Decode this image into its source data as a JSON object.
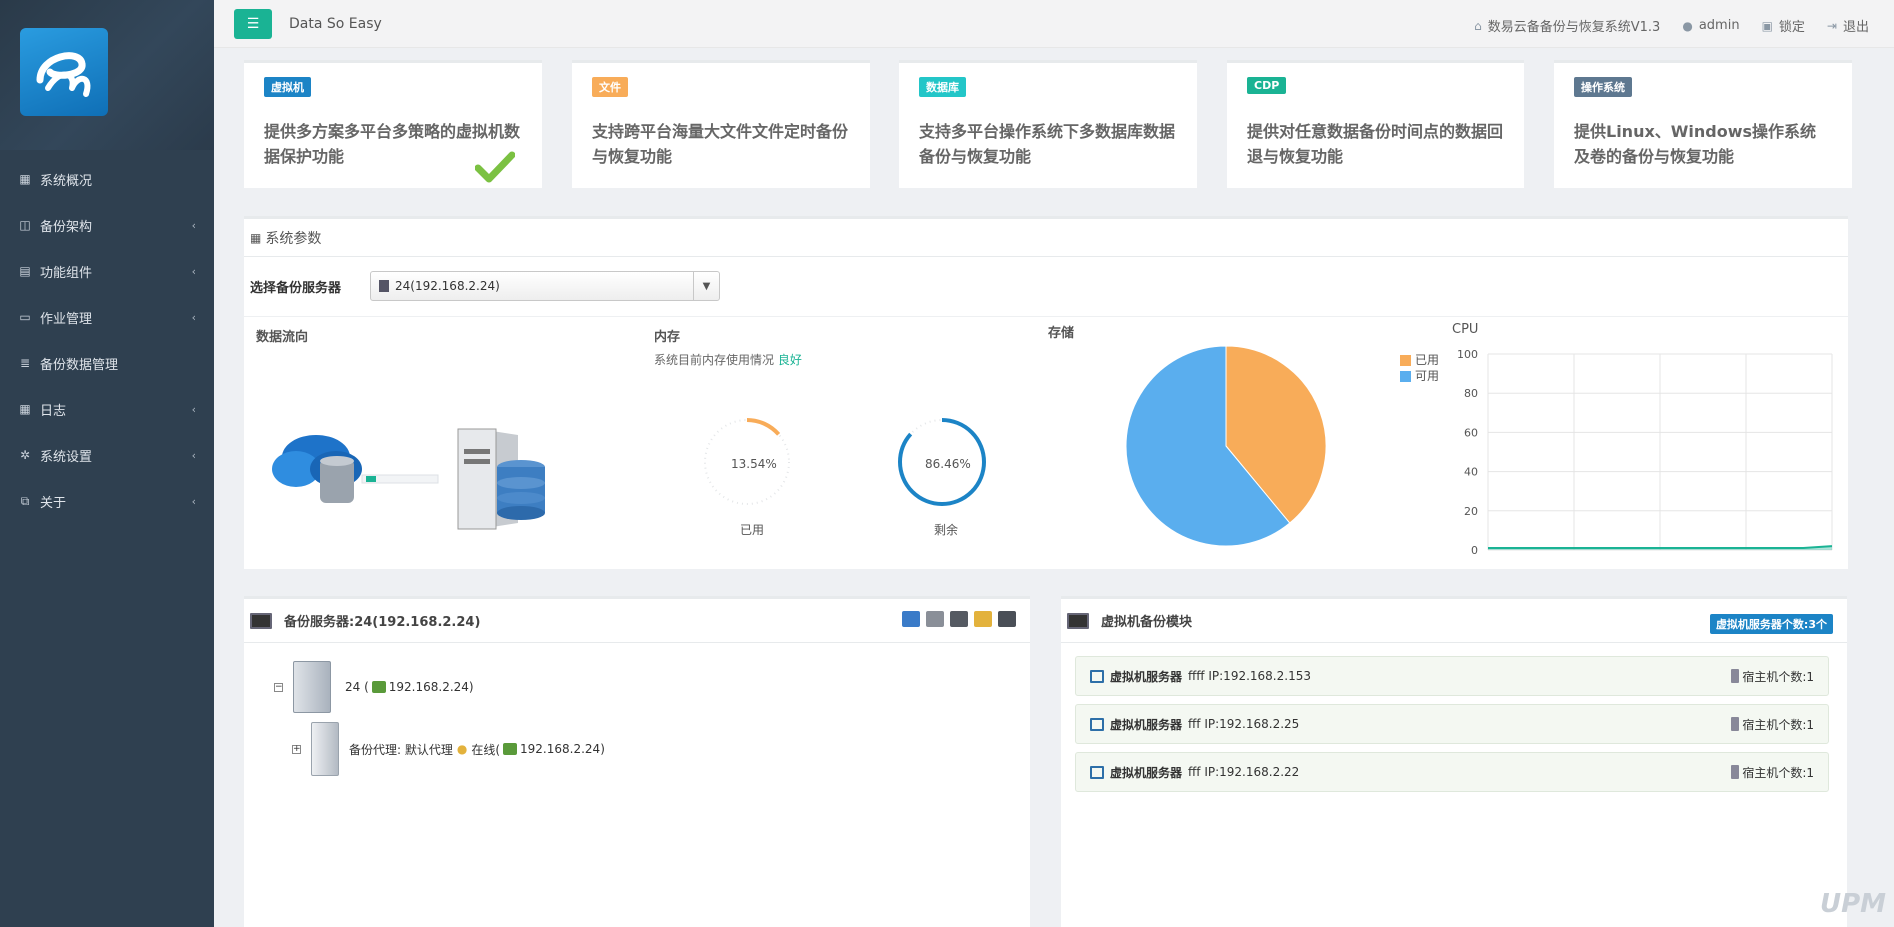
{
  "app": {
    "brand": "Data So Easy",
    "system_title": "数易云备备份与恢复系统V1.3",
    "user": "admin",
    "lock_label": "锁定",
    "logout_label": "退出"
  },
  "sidebar": {
    "items": [
      {
        "label": "系统概况",
        "icon": "dashboard-icon",
        "has_submenu": false
      },
      {
        "label": "备份架构",
        "icon": "columns-icon",
        "has_submenu": true
      },
      {
        "label": "功能组件",
        "icon": "chart-icon",
        "has_submenu": true
      },
      {
        "label": "作业管理",
        "icon": "monitor-icon",
        "has_submenu": true
      },
      {
        "label": "备份数据管理",
        "icon": "database-icon",
        "has_submenu": false
      },
      {
        "label": "日志",
        "icon": "table-icon",
        "has_submenu": true
      },
      {
        "label": "系统设置",
        "icon": "gear-icon",
        "has_submenu": true
      },
      {
        "label": "关于",
        "icon": "copy-icon",
        "has_submenu": true
      }
    ]
  },
  "features": [
    {
      "badge": "虚拟机",
      "badge_color": "#1c84c6",
      "desc": "提供多方案多平台多策略的虚拟机数据保护功能"
    },
    {
      "badge": "文件",
      "badge_color": "#f8ac59",
      "desc": "支持跨平台海量大文件文件定时备份与恢复功能"
    },
    {
      "badge": "数据库",
      "badge_color": "#23c6c8",
      "desc": "支持多平台操作系统下多数据库数据备份与恢复功能"
    },
    {
      "badge": "CDP",
      "badge_color": "#1ab394",
      "desc": "提供对任意数据备份时间点的数据回退与恢复功能"
    },
    {
      "badge": "操作系统",
      "badge_color": "#5e7890",
      "desc": "提供Linux、Windows操作系统及卷的备份与恢复功能"
    }
  ],
  "params": {
    "title": "系统参数",
    "select_label": "选择备份服务器",
    "select_value": "24(192.168.2.24)",
    "dataflow_title": "数据流向",
    "memory": {
      "title": "内存",
      "note": "系统目前内存使用情况",
      "status": "良好",
      "used_pct": 13.54,
      "used_text": "13.54%",
      "used_label": "已用",
      "free_pct": 86.46,
      "free_text": "86.46%",
      "free_label": "剩余"
    },
    "storage": {
      "title": "存储",
      "legend_used": "已用",
      "legend_free": "可用",
      "used_color": "#f8ac59",
      "free_color": "#5aaeee"
    },
    "cpu": {
      "title": "CPU",
      "yticks": [
        "100",
        "80",
        "60",
        "40",
        "20",
        "0"
      ]
    }
  },
  "chart_data": [
    {
      "type": "pie",
      "title": "存储",
      "categories": [
        "已用",
        "可用"
      ],
      "values": [
        39,
        61
      ]
    },
    {
      "type": "line",
      "title": "CPU",
      "ylim": [
        0,
        100
      ],
      "series": [
        {
          "values": [
            1,
            1,
            1,
            1,
            1,
            1,
            1,
            1,
            1,
            1,
            1,
            1,
            2
          ]
        }
      ]
    }
  ],
  "backup_server": {
    "title": "备份服务器:24(192.168.2.24)",
    "node_label": "24 (",
    "node_ip": "192.168.2.24)",
    "agent_label": "备份代理: 默认代理",
    "agent_status": "在线(",
    "agent_ip": "192.168.2.24)"
  },
  "vm_module": {
    "title": "虚拟机备份模块",
    "count_badge": "虚拟机服务器个数:3个",
    "rows": [
      {
        "name": "虚拟机服务器",
        "detail": "ffff IP:192.168.2.153",
        "hosts": "宿主机个数:1"
      },
      {
        "name": "虚拟机服务器",
        "detail": "fff IP:192.168.2.25",
        "hosts": "宿主机个数:1"
      },
      {
        "name": "虚拟机服务器",
        "detail": "fff IP:192.168.2.22",
        "hosts": "宿主机个数:1"
      }
    ]
  }
}
